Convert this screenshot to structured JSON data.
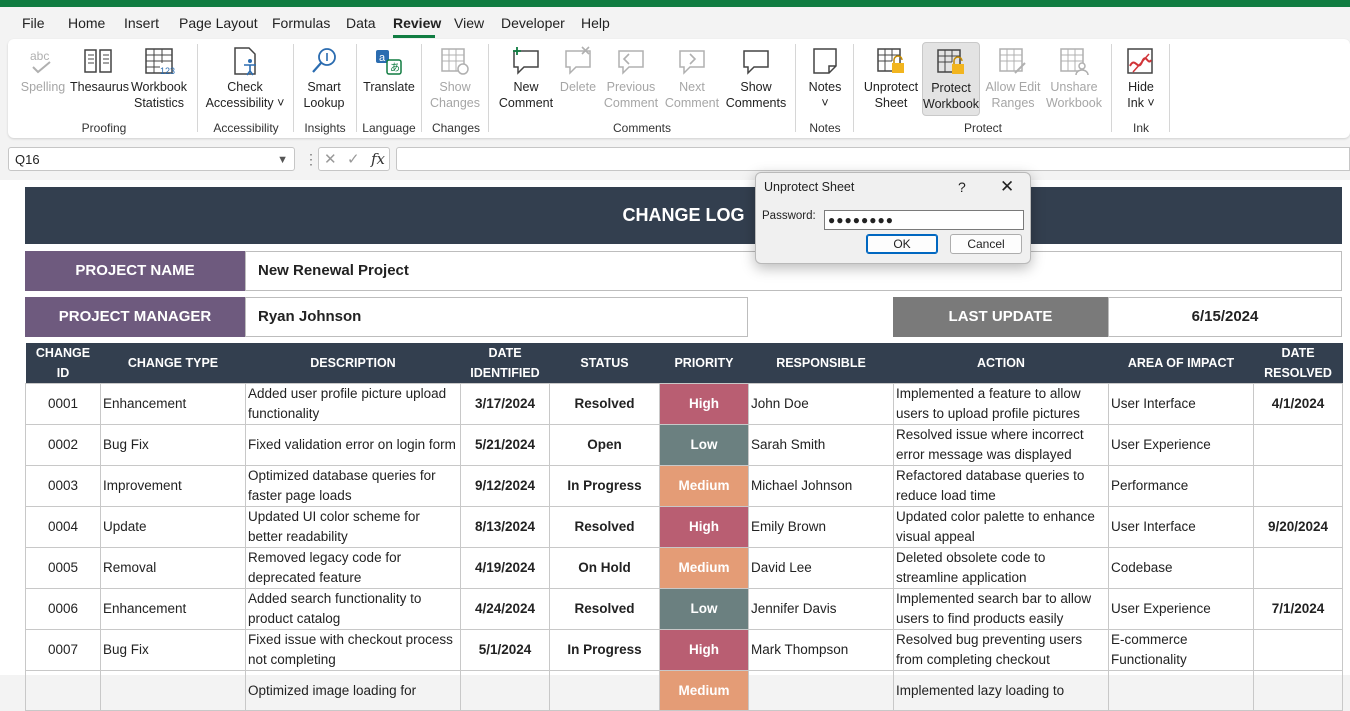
{
  "menu": {
    "items": [
      "File",
      "Home",
      "Insert",
      "Page Layout",
      "Formulas",
      "Data",
      "Review",
      "View",
      "Developer",
      "Help"
    ],
    "active": "Review"
  },
  "ribbon": {
    "groups": {
      "proofing": "Proofing",
      "accessibility": "Accessibility",
      "insights": "Insights",
      "language": "Language",
      "changes": "Changes",
      "comments": "Comments",
      "notes": "Notes",
      "protect": "Protect",
      "ink": "Ink"
    },
    "buttons": {
      "spelling": "Spelling",
      "thesaurus": "Thesaurus",
      "workbook_statistics_1": "Workbook",
      "workbook_statistics_2": "Statistics",
      "check_accessibility_1": "Check",
      "check_accessibility_2": "Accessibility ˅",
      "smart_lookup_1": "Smart",
      "smart_lookup_2": "Lookup",
      "translate": "Translate",
      "show_changes_1": "Show",
      "show_changes_2": "Changes",
      "new_comment_1": "New",
      "new_comment_2": "Comment",
      "delete": "Delete",
      "previous_comment_1": "Previous",
      "previous_comment_2": "Comment",
      "next_comment_1": "Next",
      "next_comment_2": "Comment",
      "show_comments_1": "Show",
      "show_comments_2": "Comments",
      "notes": "Notes",
      "notes_arrow": "˅",
      "unprotect_sheet_1": "Unprotect",
      "unprotect_sheet_2": "Sheet",
      "protect_workbook_1": "Protect",
      "protect_workbook_2": "Workbook",
      "allow_edit_ranges_1": "Allow Edit",
      "allow_edit_ranges_2": "Ranges",
      "unshare_workbook_1": "Unshare",
      "unshare_workbook_2": "Workbook",
      "hide_ink_1": "Hide",
      "hide_ink_2": "Ink ˅"
    }
  },
  "formula_bar": {
    "name_box": "Q16",
    "fx": "fx",
    "cancel": "✕",
    "enter": "✓",
    "value": ""
  },
  "sheet": {
    "title": "CHANGE LOG",
    "project_name_label": "PROJECT NAME",
    "project_name": "New Renewal Project",
    "project_manager_label": "PROJECT MANAGER",
    "project_manager": "Ryan Johnson",
    "last_update_label": "LAST UPDATE",
    "last_update": "6/15/2024",
    "headers": [
      [
        "CHANGE",
        "ID"
      ],
      [
        "CHANGE TYPE",
        ""
      ],
      [
        "DESCRIPTION",
        ""
      ],
      [
        "DATE",
        "IDENTIFIED"
      ],
      [
        "STATUS",
        ""
      ],
      [
        "PRIORITY",
        ""
      ],
      [
        "RESPONSIBLE",
        ""
      ],
      [
        "ACTION",
        ""
      ],
      [
        "AREA OF IMPACT",
        ""
      ],
      [
        "DATE",
        "RESOLVED"
      ]
    ],
    "priority_colors": {
      "High": "#b95e72",
      "Low": "#6b8080",
      "Medium": "#e49c76"
    },
    "rows": [
      {
        "id": "0001",
        "type": "Enhancement",
        "desc": "Added user profile picture upload functionality",
        "date": "3/17/2024",
        "status": "Resolved",
        "priority": "High",
        "resp": "John Doe",
        "action": "Implemented a feature to allow users to upload profile pictures",
        "area": "User Interface",
        "resolved": "4/1/2024"
      },
      {
        "id": "0002",
        "type": "Bug Fix",
        "desc": "Fixed validation error on login form",
        "date": "5/21/2024",
        "status": "Open",
        "priority": "Low",
        "resp": "Sarah Smith",
        "action": "Resolved issue where incorrect error message was displayed",
        "area": "User Experience",
        "resolved": ""
      },
      {
        "id": "0003",
        "type": "Improvement",
        "desc": "Optimized database queries for faster page loads",
        "date": "9/12/2024",
        "status": "In Progress",
        "priority": "Medium",
        "resp": "Michael Johnson",
        "action": "Refactored database queries to reduce load time",
        "area": "Performance",
        "resolved": ""
      },
      {
        "id": "0004",
        "type": "Update",
        "desc": "Updated UI color scheme for better readability",
        "date": "8/13/2024",
        "status": "Resolved",
        "priority": "High",
        "resp": "Emily Brown",
        "action": "Updated color palette to enhance visual appeal",
        "area": "User Interface",
        "resolved": "9/20/2024"
      },
      {
        "id": "0005",
        "type": "Removal",
        "desc": "Removed legacy code for deprecated feature",
        "date": "4/19/2024",
        "status": "On Hold",
        "priority": "Medium",
        "resp": "David Lee",
        "action": "Deleted obsolete code to streamline application",
        "area": "Codebase",
        "resolved": ""
      },
      {
        "id": "0006",
        "type": "Enhancement",
        "desc": "Added search functionality to product catalog",
        "date": "4/24/2024",
        "status": "Resolved",
        "priority": "Low",
        "resp": "Jennifer Davis",
        "action": "Implemented search bar to allow users to find products easily",
        "area": "User Experience",
        "resolved": "7/1/2024"
      },
      {
        "id": "0007",
        "type": "Bug Fix",
        "desc": "Fixed issue with checkout process not completing",
        "date": "5/1/2024",
        "status": "In Progress",
        "priority": "High",
        "resp": "Mark Thompson",
        "action": "Resolved bug preventing users from completing checkout",
        "area": "E-commerce Functionality",
        "resolved": ""
      },
      {
        "id": "",
        "type": "",
        "desc": "Optimized image loading for",
        "date": "",
        "status": "",
        "priority": "Medium",
        "resp": "",
        "action": "Implemented lazy loading to",
        "area": "",
        "resolved": ""
      }
    ]
  },
  "dialog": {
    "title": "Unprotect Sheet",
    "help": "?",
    "close": "✕",
    "password_label": "Password:",
    "password_value": "●●●●●●●●",
    "ok": "OK",
    "cancel": "Cancel"
  }
}
